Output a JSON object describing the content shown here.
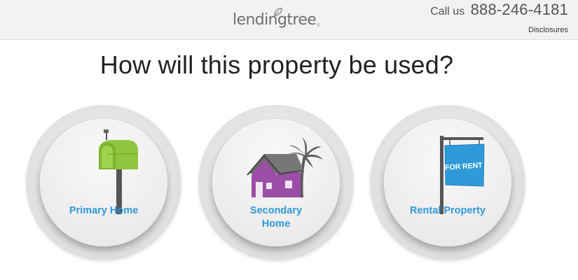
{
  "header": {
    "logo_text": "lendingtree",
    "call_label": "Call us",
    "phone": "888-246-4181",
    "disclosures_label": "Disclosures"
  },
  "question": "How will this property be used?",
  "options": [
    {
      "label_line1": "Primary Home",
      "label_line2": "",
      "icon": "mailbox-icon"
    },
    {
      "label_line1": "Secondary",
      "label_line2": "Home",
      "icon": "house-with-palm-icon"
    },
    {
      "label_line1": "Rental Property",
      "label_line2": "",
      "icon": "for-rent-sign-icon",
      "sign_text": "FOR RENT"
    }
  ],
  "colors": {
    "accent": "#2e9ad9",
    "mailbox_green": "#8ec63f",
    "house_purple": "#9b4ea6",
    "sign_blue": "#2e9ad9"
  }
}
